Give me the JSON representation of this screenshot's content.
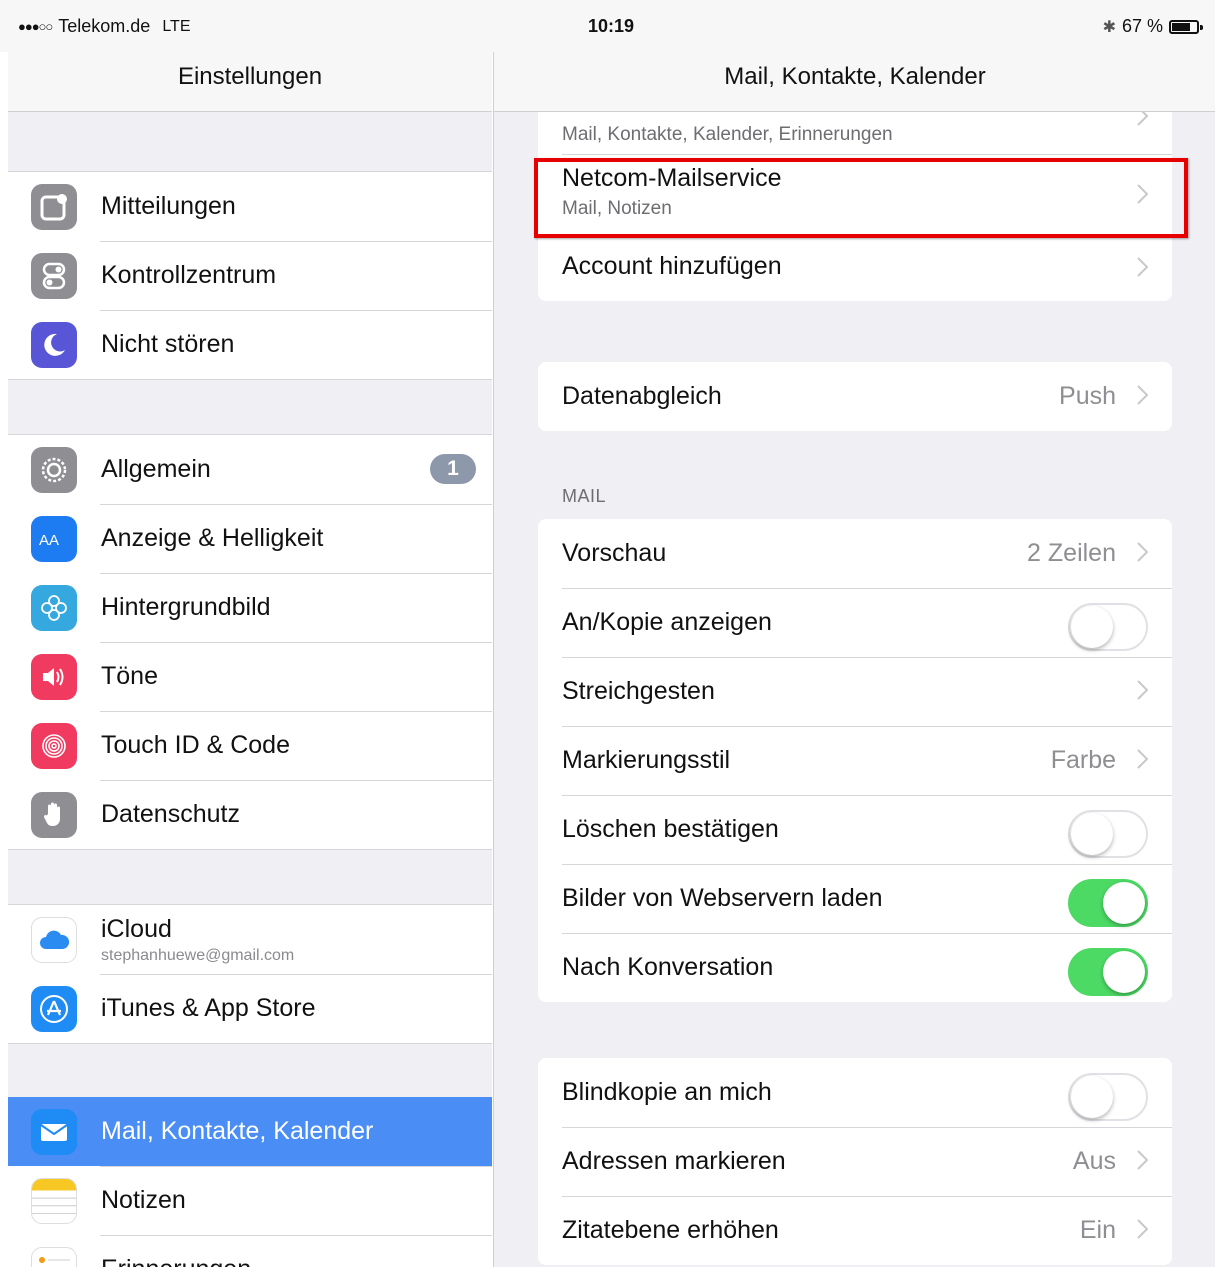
{
  "status": {
    "carrier": "Telekom.de",
    "network": "LTE",
    "signal_dots": "●●●○○",
    "time": "10:19",
    "battery": "67 %",
    "bluetooth_icon": "bluetooth-icon"
  },
  "sidebar": {
    "title": "Einstellungen",
    "items": [
      {
        "label": "Mitteilungen",
        "icon": "notifications-icon",
        "color": "#8e8e93"
      },
      {
        "label": "Kontrollzentrum",
        "icon": "control-center-icon",
        "color": "#8e8e93"
      },
      {
        "label": "Nicht stören",
        "icon": "moon-icon",
        "color": "#5856d6"
      },
      {
        "label": "Allgemein",
        "icon": "gear-icon",
        "color": "#8e8e93",
        "badge": "1"
      },
      {
        "label": "Anzeige & Helligkeit",
        "icon": "display-icon",
        "color": "#1e7cf2"
      },
      {
        "label": "Hintergrundbild",
        "icon": "wallpaper-icon",
        "color": "#35a8e0"
      },
      {
        "label": "Töne",
        "icon": "speaker-icon",
        "color": "#f03a5f"
      },
      {
        "label": "Touch ID & Code",
        "icon": "fingerprint-icon",
        "color": "#f03a5f"
      },
      {
        "label": "Datenschutz",
        "icon": "hand-icon",
        "color": "#8e8e93"
      },
      {
        "label": "iCloud",
        "sub": "stephanhuewe@gmail.com",
        "icon": "cloud-icon",
        "color": "#ffffff"
      },
      {
        "label": "iTunes & App Store",
        "icon": "app-store-icon",
        "color": "#1e8cf4"
      },
      {
        "label": "Mail, Kontakte, Kalender",
        "icon": "mail-icon",
        "color": "#1e8cf4",
        "selected": true
      },
      {
        "label": "Notizen",
        "icon": "notes-icon",
        "color": "#f7c824"
      },
      {
        "label": "Erinnerungen",
        "icon": "reminders-icon",
        "color": "#ffffff"
      }
    ]
  },
  "main": {
    "title": "Mail, Kontakte, Kalender",
    "accounts": {
      "prev_sub": "Mail, Kontakte, Kalender, Erinnerungen",
      "netcom_title": "Netcom-Mailservice",
      "netcom_sub": "Mail, Notizen",
      "add": "Account hinzufügen"
    },
    "fetch": {
      "label": "Datenabgleich",
      "value": "Push"
    },
    "mail_section": "MAIL",
    "mail": [
      {
        "label": "Vorschau",
        "value": "2 Zeilen",
        "type": "chevron"
      },
      {
        "label": "An/Kopie anzeigen",
        "type": "toggle",
        "on": false
      },
      {
        "label": "Streichgesten",
        "type": "chevron"
      },
      {
        "label": "Markierungsstil",
        "value": "Farbe",
        "type": "chevron"
      },
      {
        "label": "Löschen bestätigen",
        "type": "toggle",
        "on": false
      },
      {
        "label": "Bilder von Webservern laden",
        "type": "toggle",
        "on": true
      },
      {
        "label": "Nach Konversation",
        "type": "toggle",
        "on": true
      }
    ],
    "compose": [
      {
        "label": "Blindkopie an mich",
        "type": "toggle",
        "on": false
      },
      {
        "label": "Adressen markieren",
        "value": "Aus",
        "type": "chevron"
      },
      {
        "label": "Zitatebene erhöhen",
        "value": "Ein",
        "type": "chevron"
      }
    ]
  },
  "colors": {
    "accent": "#4a8ef5",
    "toggle_on": "#4cd964",
    "highlight": "#e60000"
  }
}
